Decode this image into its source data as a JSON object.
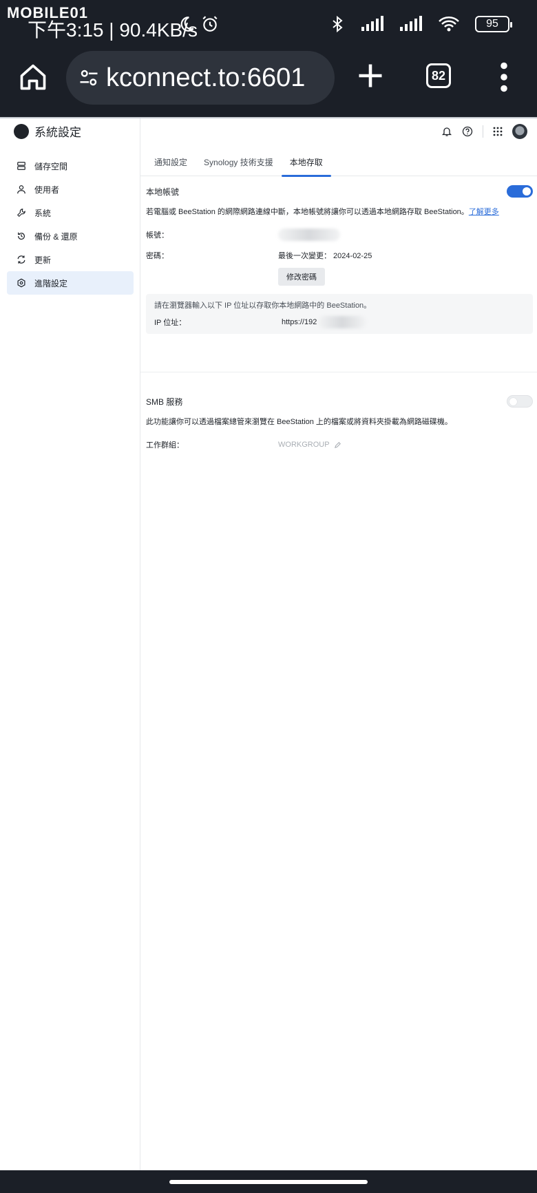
{
  "status_bar": {
    "watermark": "MOBILE01",
    "time_speed": "下午3:15 | 90.4KB/s",
    "battery": "95"
  },
  "browser": {
    "url": "kconnect.to:6601",
    "tab_count": "82"
  },
  "app": {
    "title": "系統設定"
  },
  "sidebar": {
    "items": [
      {
        "label": "儲存空間",
        "icon": "storage-icon"
      },
      {
        "label": "使用者",
        "icon": "user-icon"
      },
      {
        "label": "系統",
        "icon": "wrench-icon"
      },
      {
        "label": "備份 & 還原",
        "icon": "backup-icon"
      },
      {
        "label": "更新",
        "icon": "update-icon"
      },
      {
        "label": "進階設定",
        "icon": "advanced-icon",
        "active": true
      }
    ]
  },
  "tabs": [
    {
      "label": "通知設定"
    },
    {
      "label": "Synology 技術支援"
    },
    {
      "label": "本地存取",
      "active": true
    }
  ],
  "local_account": {
    "title": "本地帳號",
    "enabled": true,
    "description": "若電腦或 BeeStation 的網際網路連線中斷，本地帳號將讓你可以透過本地網路存取 BeeStation。",
    "learn_more": "了解更多",
    "account_label": "帳號：",
    "password_label": "密碼：",
    "last_changed": "最後一次變更： 2024-02-25",
    "change_password": "修改密碼",
    "ip_hint": "請在瀏覽器輸入以下 IP 位址以存取你本地網路中的 BeeStation。",
    "ip_label": "IP 位址：",
    "ip_value": "https://192"
  },
  "smb": {
    "title": "SMB 服務",
    "enabled": false,
    "description": "此功能讓你可以透過檔案總管來瀏覽在 BeeStation 上的檔案或將資料夾掛載為網路磁碟機。",
    "workgroup_label": "工作群組：",
    "workgroup_value": "WORKGROUP"
  },
  "colors": {
    "accent": "#2a6cd9",
    "dark_chrome": "#1b1f27",
    "active_nav_bg": "#e8f0fb"
  }
}
